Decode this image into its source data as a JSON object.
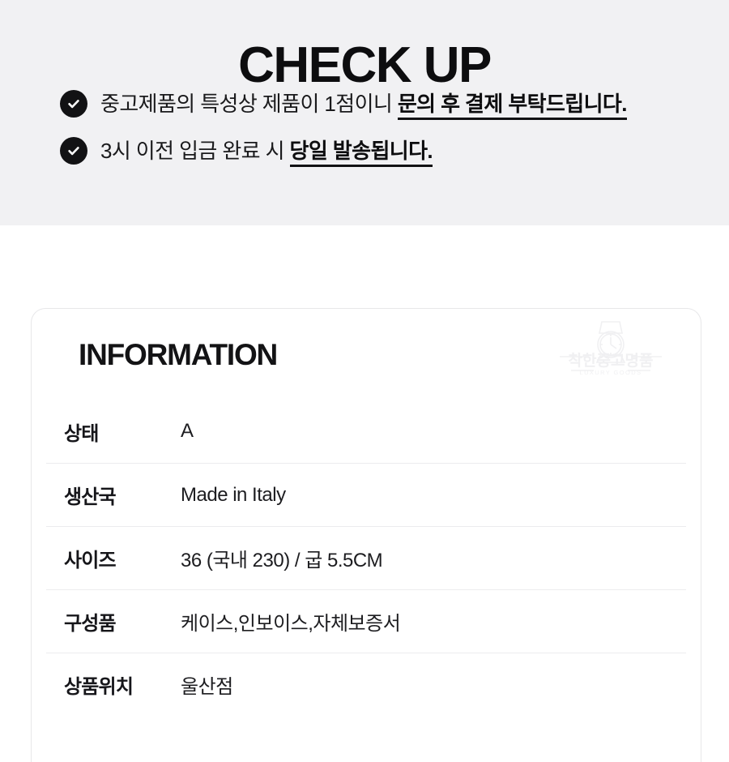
{
  "checkup": {
    "title": "CHECK UP",
    "bullets": [
      {
        "icon": "check-circle-icon",
        "normal": "중고제품의 특성상 제품이 1점이니 ",
        "emphasis": "문의 후 결제 부탁드립니다."
      },
      {
        "icon": "check-circle-icon",
        "normal": "3시 이전 입금 완료 시 ",
        "emphasis": "당일 발송됩니다."
      }
    ]
  },
  "information": {
    "title": "INFORMATION",
    "brand_mark": {
      "icon": "watch-logo-icon",
      "name_kr": "착한중고명품",
      "name_en": "LUXURY GOODS"
    },
    "rows": [
      {
        "label": "상태",
        "value": "A"
      },
      {
        "label": "생산국",
        "value": "Made in Italy"
      },
      {
        "label": "사이즈",
        "value": "36 (국내 230) / 굽 5.5CM"
      },
      {
        "label": "구성품",
        "value": "케이스,인보이스,자체보증서"
      },
      {
        "label": "상품위치",
        "value": "울산점"
      }
    ]
  },
  "colors": {
    "banner_bg": "#f1f1f3",
    "page_bg": "#ffffff",
    "ink": "#121214",
    "divider": "#ececee",
    "card_border": "#e7e7e9",
    "watermark": "#f2f2f4"
  }
}
